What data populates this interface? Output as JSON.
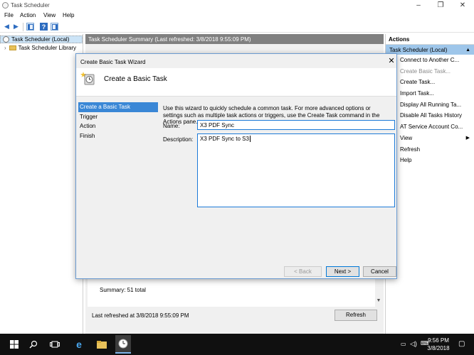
{
  "window": {
    "title": "Task Scheduler",
    "controls": [
      "–",
      "❐",
      "✕"
    ]
  },
  "menubar": [
    "File",
    "Action",
    "View",
    "Help"
  ],
  "tree": {
    "items": [
      {
        "label": "Task Scheduler (Local)",
        "icon": "clock-icon",
        "selected": true
      },
      {
        "label": "Task Scheduler Library",
        "icon": "folder-icon",
        "selected": false
      }
    ]
  },
  "center": {
    "header": "Task Scheduler Summary (Last refreshed: 3/8/2018 9:55:09 PM)",
    "summary": "Summary: 51 total",
    "last_refreshed": "Last refreshed at 3/8/2018 9:55:09 PM",
    "refresh_button": "Refresh"
  },
  "actions": {
    "header": "Actions",
    "section": "Task Scheduler (Local)",
    "items": [
      {
        "label": "Connect to Another C...",
        "disabled": false
      },
      {
        "label": "Create Basic Task...",
        "disabled": true
      },
      {
        "label": "Create Task...",
        "disabled": false
      },
      {
        "label": "Import Task...",
        "disabled": false
      },
      {
        "label": "Display All Running Ta...",
        "disabled": false
      },
      {
        "label": "Disable All Tasks History",
        "disabled": false
      },
      {
        "label": "AT Service Account Co...",
        "disabled": false
      },
      {
        "label": "View",
        "disabled": false,
        "submenu": true
      },
      {
        "label": "Refresh",
        "disabled": false
      },
      {
        "label": "Help",
        "disabled": false
      }
    ]
  },
  "dialog": {
    "title": "Create Basic Task Wizard",
    "close": "✕",
    "heading": "Create a Basic Task",
    "steps": [
      {
        "label": "Create a Basic Task",
        "active": true
      },
      {
        "label": "Trigger",
        "active": false
      },
      {
        "label": "Action",
        "active": false
      },
      {
        "label": "Finish",
        "active": false
      }
    ],
    "intro": "Use this wizard to quickly schedule a common task.  For more advanced options or settings such as multiple task actions or triggers, use the Create Task command in the Actions pane.",
    "name_label": "Name:",
    "name_value": "X3 PDF Sync",
    "description_label": "Description:",
    "description_value": "X3 PDF Sync to S3",
    "back_button": "< Back",
    "next_button": "Next >",
    "cancel_button": "Cancel"
  },
  "taskbar": {
    "time": "9:56 PM",
    "date": "3/8/2018"
  }
}
